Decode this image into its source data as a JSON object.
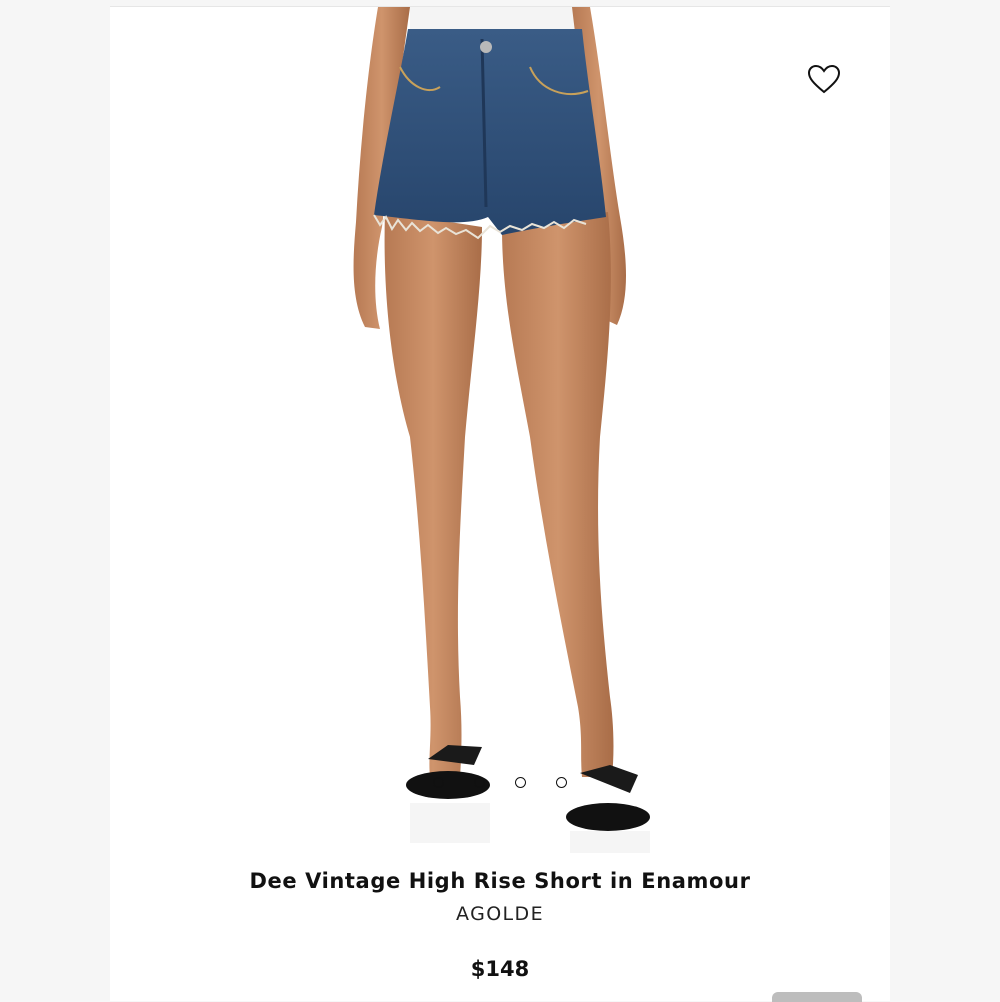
{
  "product": {
    "title": "Dee Vintage High Rise Short in Enamour",
    "brand": "AGOLDE",
    "price": "$148"
  },
  "gallery": {
    "image_count": 4,
    "active_index": 0,
    "image_alt": "model wearing denim cutoff shorts with black flip flop sandals"
  },
  "icons": {
    "favorite": "heart-outline-icon"
  },
  "colors": {
    "text": "#111111",
    "background": "#ffffff",
    "denim": "#2f4f78"
  }
}
